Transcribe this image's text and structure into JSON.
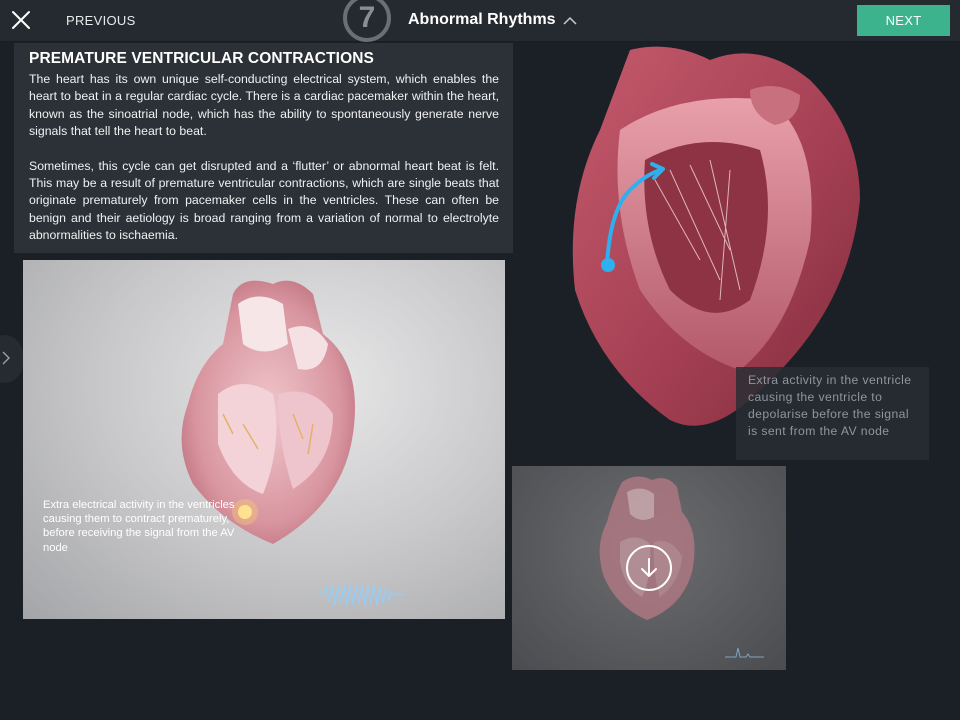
{
  "toolbar": {
    "previous_label": "PREVIOUS",
    "step_number": "7",
    "title": "Abnormal Rhythms",
    "next_label": "NEXT"
  },
  "article": {
    "heading": "PREMATURE VENTRICULAR CONTRACTIONS",
    "paragraph1": "The heart has its own unique self-conducting electrical system, which enables the heart to beat in a regular cardiac cycle. There is a cardiac pacemaker within the heart, known as the sinoatrial node, which has the ability to spontaneously generate nerve signals that tell the heart to beat.",
    "paragraph2": "Sometimes, this cycle can get disrupted and a ‘flutter’ or abnormal heart beat is felt. This may be a result of premature ventricular contractions, which are single beats that originate prematurely from pacemaker cells in the ventricles. These can often be benign and their aetiology is broad ranging from a variation of normal to electrolyte abnormalities to ischaemia."
  },
  "main_video": {
    "caption": "Extra electrical activity in the ventricles causing them to contract prematurely, before receiving the signal from the AV node"
  },
  "annotation": {
    "text": "Extra activity in the ventricle causing the ventricle to depolarise before the signal is sent from the AV node"
  },
  "icons": {
    "close": "close-icon",
    "chevron_up": "chevron-up-icon",
    "side": "chevron-right-icon",
    "download": "arrow-down-icon"
  },
  "colors": {
    "accent": "#3cb38c",
    "signal": "#29a6e6"
  }
}
